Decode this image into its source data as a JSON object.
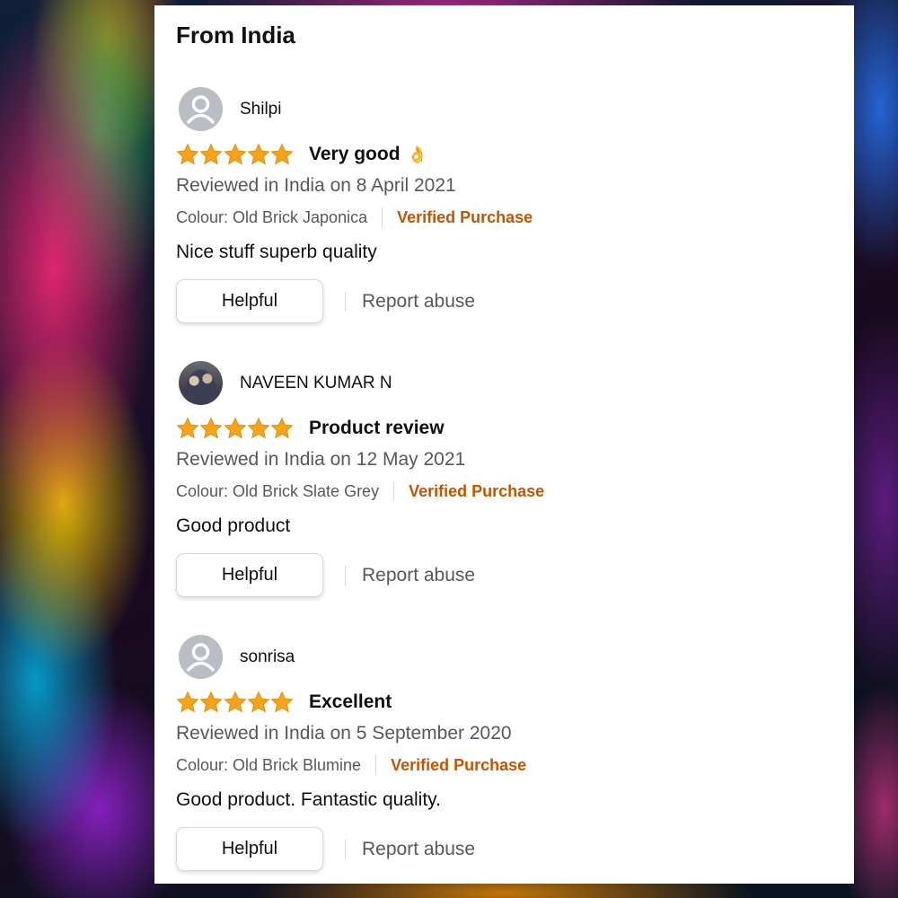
{
  "section": {
    "heading": "From India"
  },
  "theme": {
    "star_color": "#f5a21c",
    "verified_color": "#c45500"
  },
  "reviews": [
    {
      "name": "Shilpi",
      "avatar": "default-avatar-icon",
      "rating": 5,
      "title": "Very good",
      "title_emoji": "👌",
      "date": "Reviewed in India on 8 April 2021",
      "colour": "Colour: Old Brick Japonica",
      "verified": "Verified Purchase",
      "body": "Nice stuff superb quality",
      "helpful_label": "Helpful",
      "report_label": "Report abuse"
    },
    {
      "name": "NAVEEN KUMAR N",
      "avatar": "user-photo",
      "rating": 5,
      "title": "Product review",
      "date": "Reviewed in India on 12 May 2021",
      "colour": "Colour: Old Brick Slate Grey",
      "verified": "Verified Purchase",
      "body": "Good product",
      "helpful_label": "Helpful",
      "report_label": "Report abuse"
    },
    {
      "name": "sonrisa",
      "avatar": "default-avatar-icon",
      "rating": 5,
      "title": "Excellent",
      "date": "Reviewed in India on 5 September 2020",
      "colour": "Colour: Old Brick Blumine",
      "verified": "Verified Purchase",
      "body": "Good product. Fantastic quality.",
      "helpful_label": "Helpful",
      "report_label": "Report abuse"
    }
  ]
}
